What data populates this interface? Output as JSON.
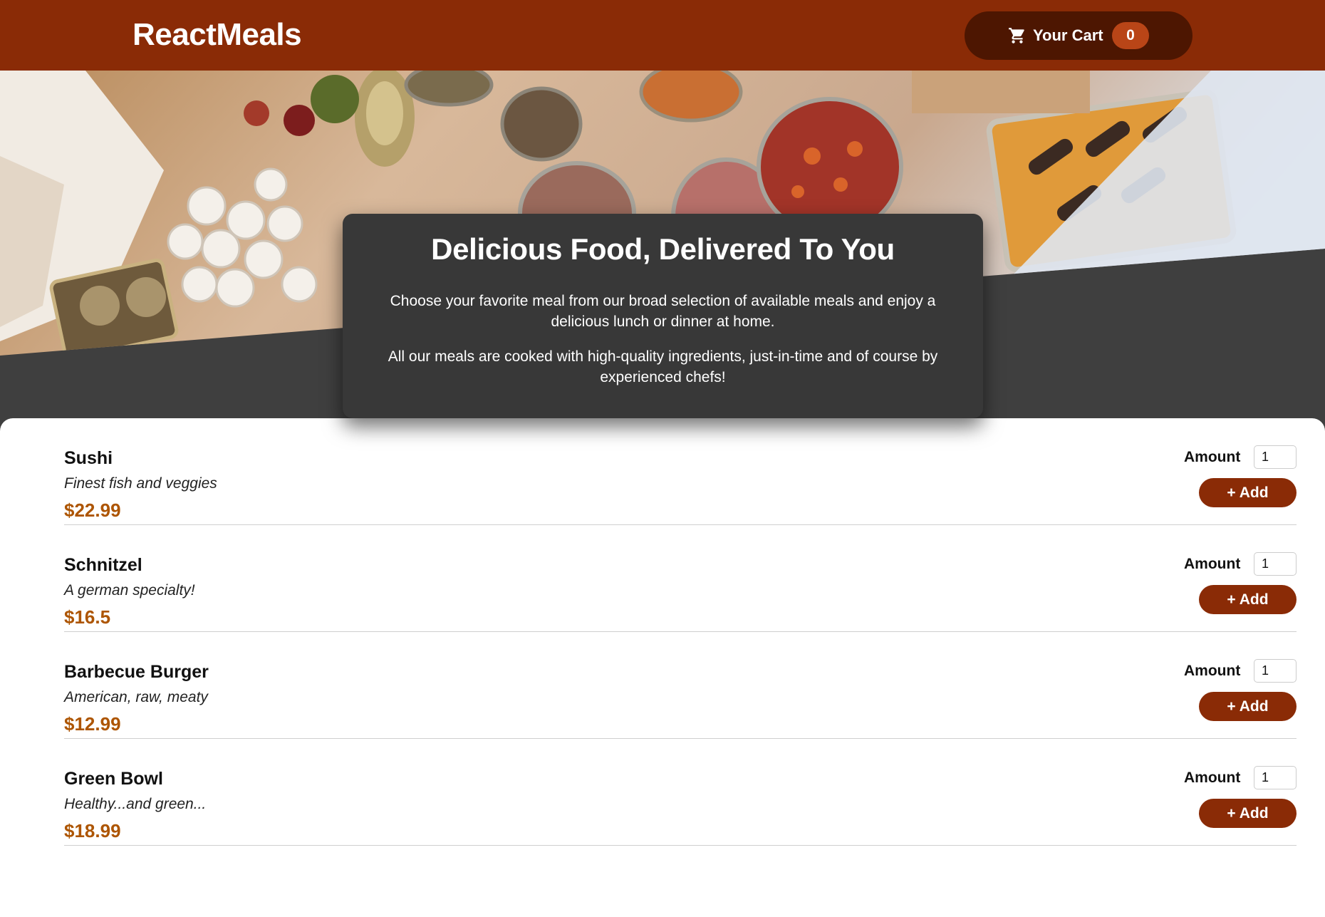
{
  "header": {
    "logo": "ReactMeals",
    "cart": {
      "label": "Your Cart",
      "count": "0",
      "icon": "cart-icon"
    }
  },
  "summary": {
    "title": "Delicious Food, Delivered To You",
    "paragraphs": [
      "Choose your favorite meal from our broad selection of available meals and enjoy a delicious lunch or dinner at home.",
      "All our meals are cooked with high-quality ingredients, just-in-time and of course by experienced chefs!"
    ]
  },
  "meals": [
    {
      "name": "Sushi",
      "description": "Finest fish and veggies",
      "price": "$22.99",
      "amount_label": "Amount",
      "amount": "1",
      "add_label": "+ Add"
    },
    {
      "name": "Schnitzel",
      "description": "A german specialty!",
      "price": "$16.5",
      "amount_label": "Amount",
      "amount": "1",
      "add_label": "+ Add"
    },
    {
      "name": "Barbecue Burger",
      "description": "American, raw, meaty",
      "price": "$12.99",
      "amount_label": "Amount",
      "amount": "1",
      "add_label": "+ Add"
    },
    {
      "name": "Green Bowl",
      "description": "Healthy...and green...",
      "price": "$18.99",
      "amount_label": "Amount",
      "amount": "1",
      "add_label": "+ Add"
    }
  ],
  "colors": {
    "header": "#8a2b06",
    "cart_button": "#4d1601",
    "badge": "#b94517",
    "price": "#ad5502",
    "page_background": "#3f3f3f"
  }
}
